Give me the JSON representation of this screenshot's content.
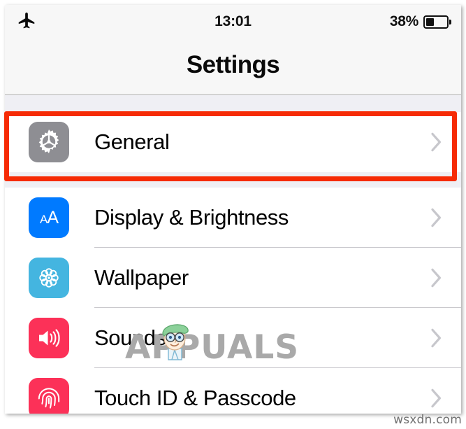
{
  "status_bar": {
    "airplane_icon": "airplane-mode-icon",
    "time": "13:01",
    "battery_percent_label": "38%",
    "battery_level": 38,
    "battery_icon": "battery-icon"
  },
  "nav_bar": {
    "title": "Settings"
  },
  "list": {
    "groups": [
      {
        "rows": [
          {
            "label": "General",
            "icon": "gear-icon",
            "icon_bg": "#8e8e93",
            "chevron": "chevron-right-icon",
            "highlighted": true
          }
        ]
      },
      {
        "rows": [
          {
            "label": "Display & Brightness",
            "icon": "text-size-aa-icon",
            "icon_bg": "#007aff",
            "chevron": "chevron-right-icon",
            "highlighted": false
          },
          {
            "label": "Wallpaper",
            "icon": "wallpaper-flower-icon",
            "icon_bg": "#44b5e0",
            "chevron": "chevron-right-icon",
            "highlighted": false
          },
          {
            "label": "Sounds",
            "icon": "speaker-volume-icon",
            "icon_bg": "#fc3158",
            "chevron": "chevron-right-icon",
            "highlighted": false
          },
          {
            "label": "Touch ID & Passcode",
            "icon": "fingerprint-icon",
            "icon_bg": "#fc3158",
            "chevron": "chevron-right-icon",
            "highlighted": false
          }
        ]
      }
    ]
  },
  "annotation": {
    "highlight_color": "#f62b05",
    "target": "General"
  },
  "watermarks": {
    "brand": "APPUALS",
    "brand_mascot": "appuals-mascot-icon",
    "site": "wsxdn.com"
  }
}
